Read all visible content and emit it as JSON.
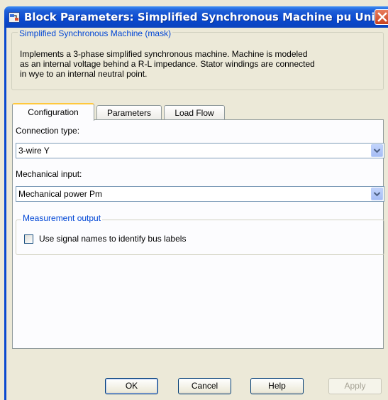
{
  "window": {
    "title": "Block Parameters: Simplified Synchronous Machine pu Units"
  },
  "mask": {
    "legend": "Simplified Synchronous Machine (mask)",
    "description_lines": [
      "Implements a 3-phase simplified synchronous machine. Machine is modeled",
      "as an internal voltage behind a R-L impedance. Stator windings are connected",
      "in wye to an internal neutral point."
    ]
  },
  "tabs": [
    {
      "label": "Configuration",
      "active": true
    },
    {
      "label": "Parameters",
      "active": false
    },
    {
      "label": "Load Flow",
      "active": false
    }
  ],
  "config": {
    "connection_label": "Connection type:",
    "connection_value": "3-wire Y",
    "mech_label": "Mechanical input:",
    "mech_value": "Mechanical power Pm",
    "measurement_legend": "Measurement output",
    "signal_names_label": "Use signal names to identify bus labels",
    "signal_names_checked": false
  },
  "buttons": {
    "ok": "OK",
    "cancel": "Cancel",
    "help": "Help",
    "apply": "Apply"
  },
  "icons": {
    "window_icon": "simulink-block-icon",
    "close": "close-icon",
    "dropdown": "chevron-down-icon"
  }
}
